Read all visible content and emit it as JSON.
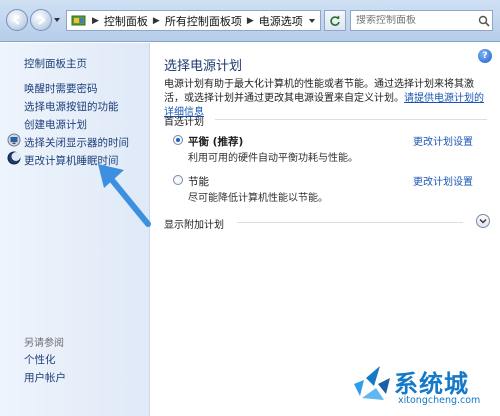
{
  "address_bar": {
    "crumbs": [
      "控制面板",
      "所有控制面板项",
      "电源选项"
    ],
    "search_placeholder": "搜索控制面板"
  },
  "sidebar": {
    "home": "控制面板主页",
    "links": [
      "唤醒时需要密码",
      "选择电源按钮的功能",
      "创建电源计划",
      "选择关闭显示器的时间",
      "更改计算机睡眠时间"
    ],
    "see_also_header": "另请参阅",
    "see_also": [
      "个性化",
      "用户帐户"
    ]
  },
  "main": {
    "title": "选择电源计划",
    "description": "电源计划有助于最大化计算机的性能或者节能。通过选择计划来将其激活，或选择计划并通过更改其电源设置来自定义计划。",
    "description_link": "请提供电源计划的详细信息",
    "preferred_header": "首选计划",
    "plans": [
      {
        "name": "平衡 (推荐)",
        "description": "利用可用的硬件自动平衡功耗与性能。",
        "link": "更改计划设置",
        "selected": true
      },
      {
        "name": "节能",
        "description": "尽可能降低计算机性能以节能。",
        "link": "更改计划设置",
        "selected": false
      }
    ],
    "additional_header": "显示附加计划"
  },
  "watermark": {
    "cn": "系统城",
    "en": "xitongcheng.com"
  },
  "colors": {
    "arrow": "#3d8fe0",
    "link": "#1a55b4",
    "sidebar_link": "#1d3f7a"
  }
}
